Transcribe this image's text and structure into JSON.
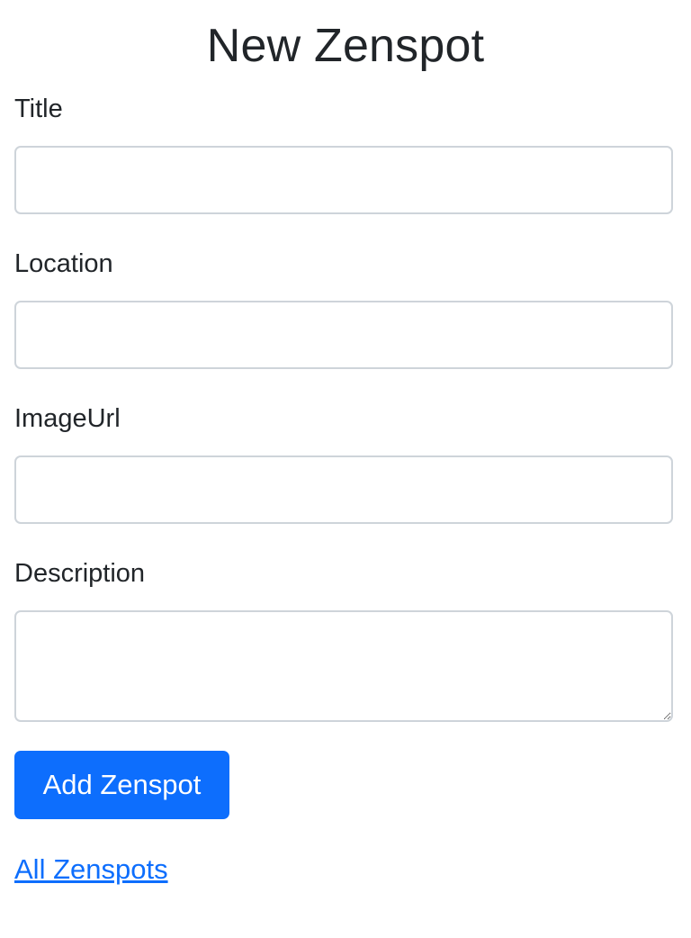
{
  "page": {
    "title": "New Zenspot"
  },
  "form": {
    "fields": [
      {
        "label": "Title",
        "value": ""
      },
      {
        "label": "Location",
        "value": ""
      },
      {
        "label": "ImageUrl",
        "value": ""
      },
      {
        "label": "Description",
        "value": ""
      }
    ],
    "submit_label": "Add Zenspot"
  },
  "nav": {
    "all_link": "All Zenspots"
  },
  "colors": {
    "primary": "#0d6efd",
    "text": "#212529",
    "input_border": "#ced4da"
  }
}
